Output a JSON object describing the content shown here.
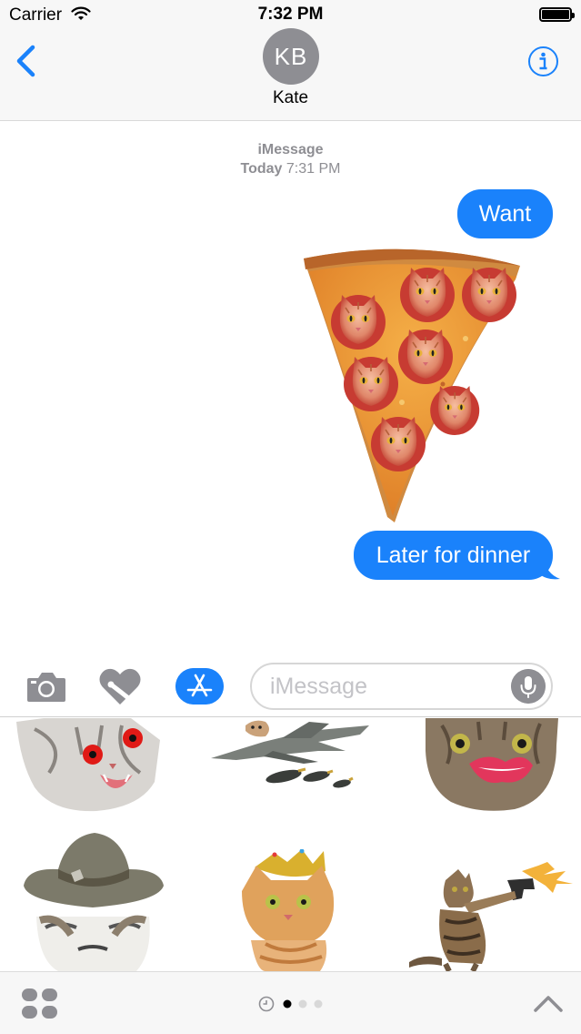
{
  "status_bar": {
    "carrier": "Carrier",
    "time": "7:32 PM"
  },
  "header": {
    "avatar_initials": "KB",
    "contact_name": "Kate"
  },
  "conversation": {
    "service": "iMessage",
    "timestamp_day": "Today",
    "timestamp_time": "7:31 PM",
    "messages": [
      {
        "type": "text",
        "text": "Want"
      },
      {
        "type": "sticker",
        "sticker": "cat-pizza-slice"
      },
      {
        "type": "text",
        "text": "Later for dinner"
      }
    ]
  },
  "composer": {
    "placeholder": "iMessage",
    "value": ""
  },
  "sticker_tray": {
    "items": [
      "red-eyed-cat",
      "cat-fighter-jet",
      "cat-with-lips",
      "grumpy-cat-ranger-hat",
      "crowned-cat",
      "cat-with-gun"
    ]
  },
  "bottom_bar": {
    "pages": 3,
    "current_page": 1
  },
  "colors": {
    "accent": "#1a82fb",
    "avatar_gray": "#8e8e93",
    "header_bg": "#f7f7f7"
  }
}
